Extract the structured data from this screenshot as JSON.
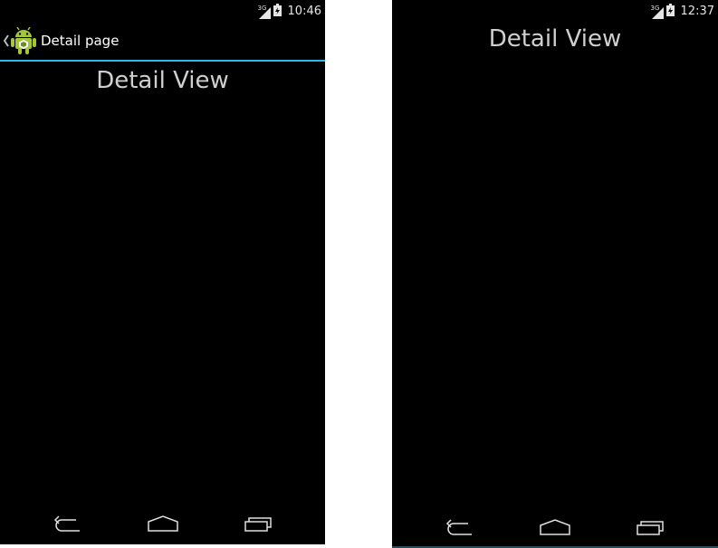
{
  "left": {
    "status": {
      "network": "3G",
      "time": "10:46"
    },
    "action_bar": {
      "title": "Detail page"
    },
    "content": {
      "text": "Detail View"
    }
  },
  "right": {
    "status": {
      "network": "3G",
      "time": "12:37"
    },
    "content": {
      "text": "Detail View"
    }
  },
  "nav_icons": [
    "back-icon",
    "home-icon",
    "recents-icon"
  ],
  "colors": {
    "accent": "#33b5e5",
    "background": "#000000",
    "text": "#cfcfcf",
    "android_green": "#a4c639"
  }
}
